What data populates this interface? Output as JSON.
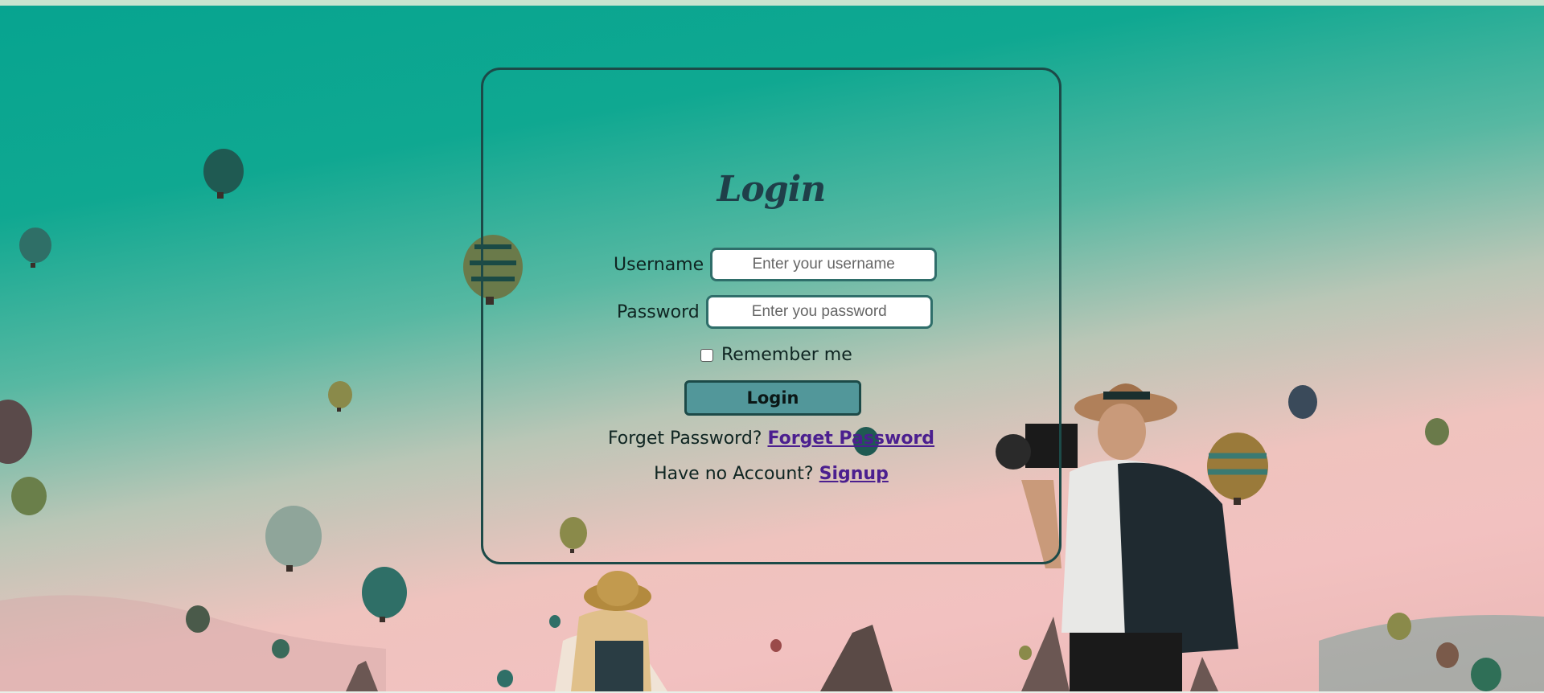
{
  "login": {
    "title": "Login",
    "username_label": "Username",
    "username_placeholder": "Enter your username",
    "password_label": "Password",
    "password_placeholder": "Enter you password",
    "remember_label": "Remember me",
    "submit_label": "Login",
    "forget_prompt": "Forget Password?",
    "forget_link": "Forget Password",
    "signup_prompt": "Have no Account?",
    "signup_link": "Signup"
  },
  "colors": {
    "card_border": "#1c4a48",
    "button_fill": "#52979a",
    "link": "#4b1f8f",
    "sky_top": "#07a490",
    "sky_bottom": "#f2c1c0"
  }
}
